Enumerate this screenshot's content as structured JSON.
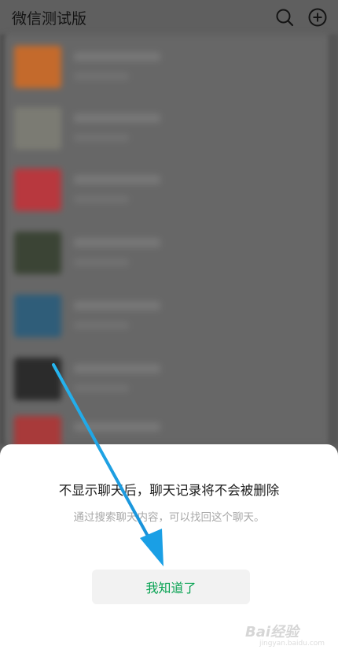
{
  "header": {
    "title": "微信测试版",
    "icons": [
      "search-icon",
      "add-circle-icon"
    ]
  },
  "dialog": {
    "message": "不显示聊天后，聊天记录将不会被删除",
    "sub_message": "通过搜索聊天内容，可以找回这个聊天。",
    "confirm_label": "我知道了",
    "confirm_color": "#07a252"
  },
  "chat_list": {
    "avatar_colors": [
      "#c46a2c",
      "#7b7b73",
      "#b8383e",
      "#3b4435",
      "#2f5d79",
      "#2b2b2b",
      "#a83a3a"
    ]
  },
  "annotation": {
    "arrow_color": "#1a9fe5"
  },
  "watermark": {
    "text": "Bai经验",
    "domain": "jingyan.baidu.com"
  }
}
